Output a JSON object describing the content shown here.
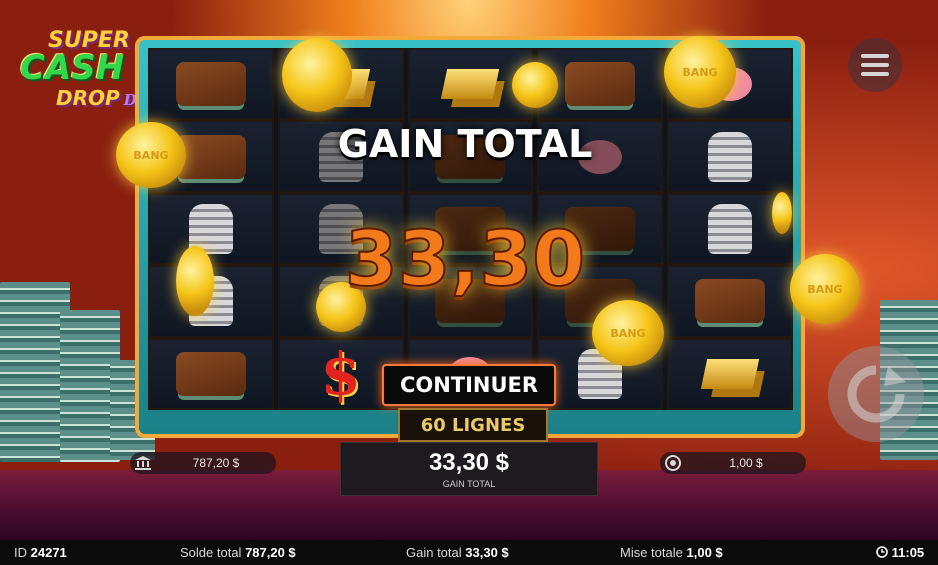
{
  "game": {
    "logo": {
      "line1": "SUPER",
      "line2": "CASH",
      "line3": "DROP",
      "line3_script": "Deluxe"
    },
    "coin_text": "BANG",
    "reels": [
      [
        "wallet",
        "wallet",
        "coins",
        "coins",
        "wallet"
      ],
      [
        "gold",
        "coins",
        "coins",
        "coins",
        "dollar"
      ],
      [
        "gold",
        "wallet",
        "wallet",
        "wallet",
        "pig"
      ],
      [
        "wallet",
        "pig",
        "wallet",
        "wallet",
        "coins"
      ],
      [
        "pig",
        "coins",
        "coins",
        "wallet",
        "gold"
      ]
    ]
  },
  "win_overlay": {
    "title": "GAIN TOTAL",
    "amount": "33,30",
    "continue_label": "CONTINUER",
    "lines_label": "60 LIGNES"
  },
  "bottom_bar": {
    "balance_value": "787,20 $",
    "win_amount": "33,30 $",
    "win_label": "GAIN TOTAL",
    "bet_value": "1,00 $"
  },
  "status_bar": {
    "id_label": "ID",
    "id_value": "24271",
    "balance_label": "Solde total",
    "balance_value": "787,20 $",
    "win_label": "Gain total",
    "win_value": "33,30 $",
    "bet_label": "Mise totale",
    "bet_value": "1,00 $",
    "time": "11:05"
  },
  "icons": [
    "menu-icon",
    "spin-icon",
    "bank-icon",
    "chip-icon",
    "clock-icon"
  ],
  "colors": {
    "accent_orange": "#f27a1a",
    "button_glow": "#ff7a3a",
    "frame_teal": "#39c3c9"
  }
}
